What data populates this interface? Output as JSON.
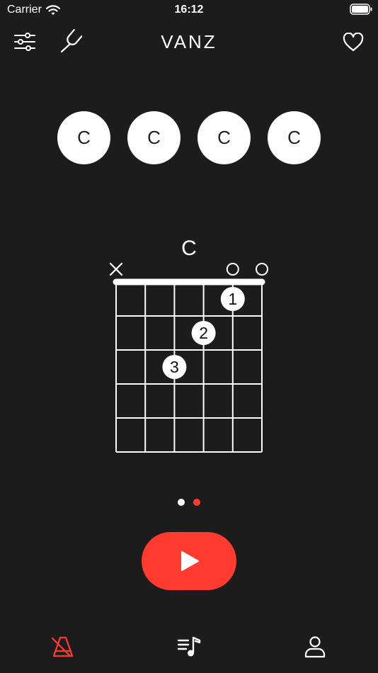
{
  "status_bar": {
    "carrier": "Carrier",
    "time": "16:12"
  },
  "header": {
    "title": "VANZ"
  },
  "chord_selector": {
    "items": [
      {
        "label": "C",
        "active": true
      },
      {
        "label": "C",
        "active": false
      },
      {
        "label": "C",
        "active": false
      },
      {
        "label": "C",
        "active": false
      }
    ]
  },
  "chord_diagram": {
    "name": "C",
    "strings": 6,
    "frets": 5,
    "string_markers": [
      "x",
      "",
      "",
      "",
      "o",
      "o"
    ],
    "fingers": [
      {
        "string": 5,
        "fret": 1,
        "finger": "1"
      },
      {
        "string": 4,
        "fret": 2,
        "finger": "2"
      },
      {
        "string": 3,
        "fret": 3,
        "finger": "3"
      }
    ]
  },
  "pager": {
    "count": 2,
    "current": 2
  },
  "colors": {
    "background": "#1c1c1c",
    "accent": "#ff3b30",
    "foreground": "#ffffff"
  },
  "tab_bar": {
    "items": [
      {
        "icon": "metronome-icon",
        "active": true
      },
      {
        "icon": "music-list-icon",
        "active": false
      },
      {
        "icon": "person-icon",
        "active": false
      }
    ]
  }
}
